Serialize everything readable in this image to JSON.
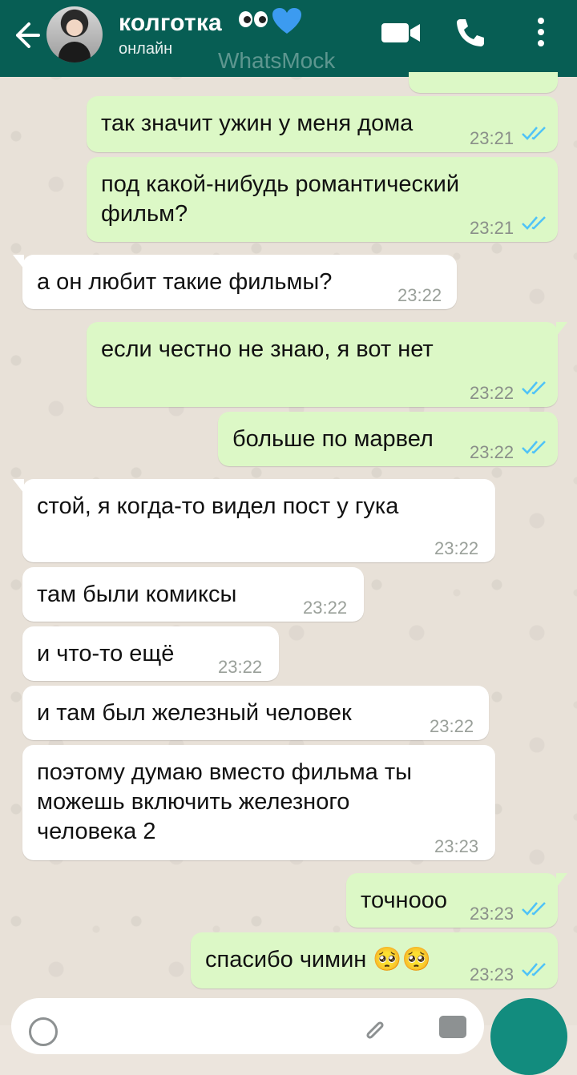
{
  "header": {
    "contact_name": "колготка",
    "status": "онлайн",
    "watermark": "WhatsMock"
  },
  "messages": [
    {
      "direction": "out",
      "text": "так значит ужин у меня дома",
      "time": "23:21",
      "read": true
    },
    {
      "direction": "out",
      "text": "под какой-нибудь романтический фильм?",
      "time": "23:21",
      "read": true
    },
    {
      "direction": "in",
      "text": "а он любит такие фильмы?",
      "time": "23:22"
    },
    {
      "direction": "out",
      "text": "если честно не знаю, я вот нет",
      "time": "23:22",
      "read": true
    },
    {
      "direction": "out",
      "text": "больше по марвел",
      "time": "23:22",
      "read": true
    },
    {
      "direction": "in",
      "text": "стой, я когда-то видел пост у гука",
      "time": "23:22"
    },
    {
      "direction": "in",
      "text": "там были комиксы",
      "time": "23:22"
    },
    {
      "direction": "in",
      "text": "и что-то ещё",
      "time": "23:22"
    },
    {
      "direction": "in",
      "text": "и там был железный человек",
      "time": "23:22"
    },
    {
      "direction": "in",
      "text": "поэтому думаю вместо фильма ты можешь включить железного человека 2",
      "time": "23:23"
    },
    {
      "direction": "out",
      "text": "точнооо",
      "time": "23:23",
      "read": true
    },
    {
      "direction": "out",
      "text": "спасибо чимин 🥺🥺",
      "time": "23:23",
      "read": true
    }
  ],
  "colors": {
    "header": "#075e54",
    "outgoing_bubble": "#dcf8c6",
    "incoming_bubble": "#ffffff",
    "read_check": "#4fc3f7",
    "accent": "#128c7e"
  },
  "icons": [
    "back-arrow-icon",
    "heart-icon",
    "video-call-icon",
    "phone-call-icon",
    "more-options-icon",
    "double-check-icon",
    "emoji-icon",
    "attach-icon",
    "camera-icon",
    "mic-icon"
  ]
}
